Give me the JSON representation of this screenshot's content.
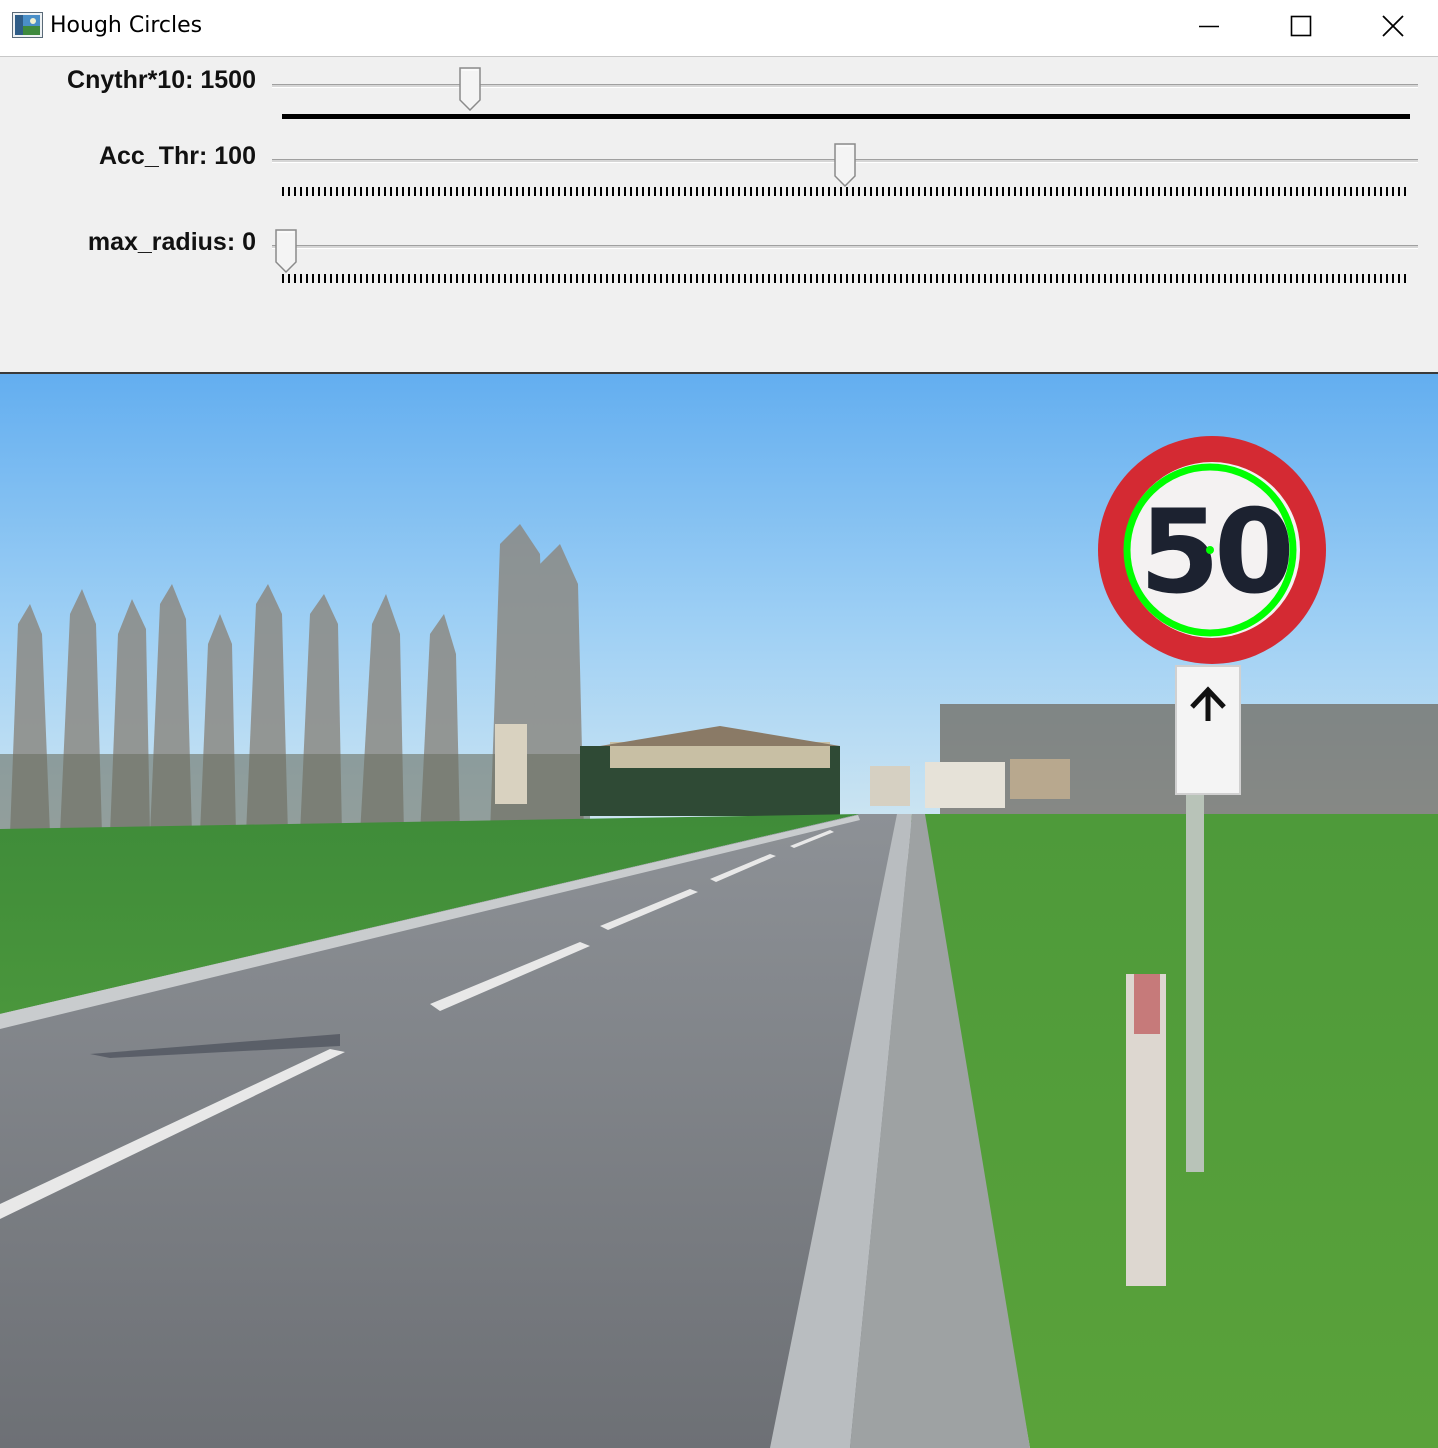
{
  "window": {
    "title": "Hough Circles",
    "controls": [
      "minimize",
      "maximize",
      "close"
    ]
  },
  "trackbars": [
    {
      "label": "Cnythr*10: 1500",
      "position": 0.17,
      "ticks": "solid"
    },
    {
      "label": "Acc_Thr: 100",
      "position": 0.5,
      "ticks": "dotted"
    },
    {
      "label": "max_radius: 0",
      "position": 0.0,
      "ticks": "dotted"
    }
  ],
  "image": {
    "sign_text": "50",
    "detected_circle_color": "#00ff00",
    "sign_ring_color": "#d42a33"
  },
  "colors": {
    "panel_bg": "#f0f0f0",
    "titlebar_bg": "#ffffff"
  }
}
